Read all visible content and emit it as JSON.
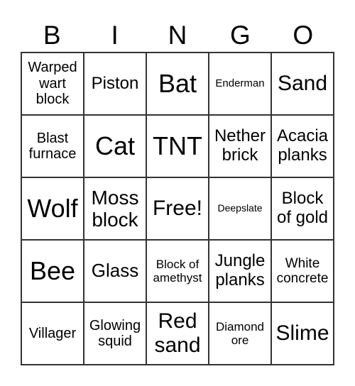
{
  "header": [
    "B",
    "I",
    "N",
    "G",
    "O"
  ],
  "cells": [
    "Warped wart block",
    "Piston",
    "Bat",
    "Enderman",
    "Sand",
    "Blast furnace",
    "Cat",
    "TNT",
    "Nether brick",
    "Acacia planks",
    "Wolf",
    "Moss block",
    "Free!",
    "Deepslate",
    "Block of gold",
    "Bee",
    "Glass",
    "Block of amethyst",
    "Jungle planks",
    "White concrete",
    "Villager",
    "Glowing squid",
    "Red sand",
    "Diamond ore",
    "Slime"
  ]
}
